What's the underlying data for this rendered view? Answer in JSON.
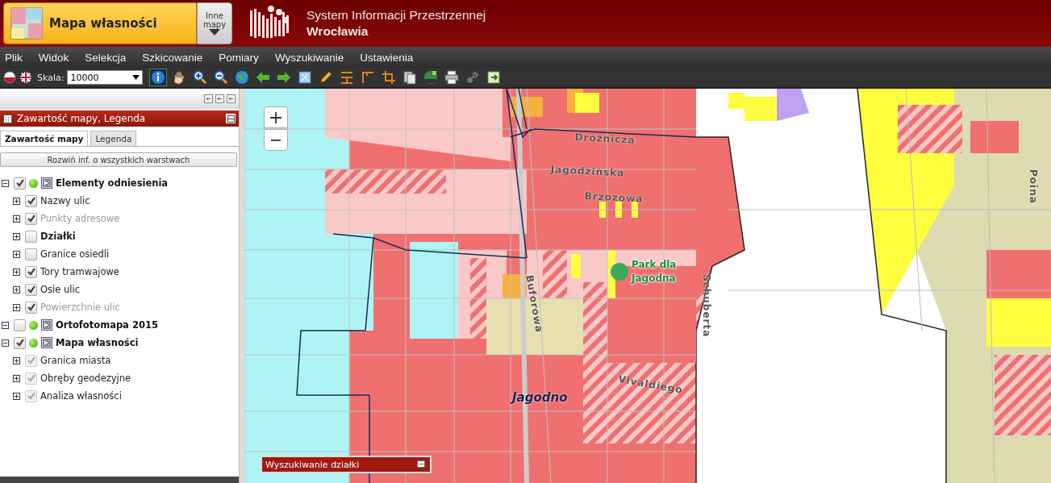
{
  "header": {
    "map_name": "Mapa własności",
    "other_maps": [
      "Inne",
      "mapy"
    ],
    "title": [
      "System Informacji Przestrzennej",
      "Wrocławia"
    ]
  },
  "menu": [
    {
      "label": "Plik"
    },
    {
      "label": "Widok"
    },
    {
      "label": "Selekcja"
    },
    {
      "label": "Szkicowanie"
    },
    {
      "label": "Pomiary"
    },
    {
      "label": "Wyszukiwanie"
    },
    {
      "label": "Ustawienia"
    }
  ],
  "toolbar": {
    "scale_label": "Skala:",
    "scale_value": "10000",
    "tools": [
      {
        "kind": "info",
        "selected": true
      },
      {
        "kind": "pan",
        "selected": false
      },
      {
        "kind": "zoom-in",
        "selected": false
      },
      {
        "kind": "zoom-out",
        "selected": false
      },
      {
        "kind": "globe",
        "selected": false
      },
      {
        "kind": "back",
        "selected": false
      },
      {
        "kind": "forward",
        "selected": false
      },
      {
        "kind": "extent",
        "selected": false
      },
      {
        "kind": "pencil",
        "selected": false
      },
      {
        "kind": "measure-h",
        "selected": false
      },
      {
        "kind": "measure-a",
        "selected": false
      },
      {
        "kind": "crop",
        "selected": false
      },
      {
        "kind": "layers",
        "selected": false
      },
      {
        "kind": "wfs",
        "selected": false
      },
      {
        "kind": "print",
        "selected": false
      },
      {
        "kind": "link",
        "selected": false
      },
      {
        "kind": "export",
        "selected": false
      }
    ]
  },
  "panel": {
    "title": "Zawartość mapy, Legenda",
    "tabs": [
      {
        "label": "Zawartość mapy",
        "selected": true
      },
      {
        "label": "Legenda",
        "selected": false
      }
    ],
    "expand_button": "Rozwiń inf. o wszystkich warstwach",
    "layers": [
      {
        "label": "Elementy odniesienia",
        "checked": true,
        "expanded": true,
        "children": [
          {
            "label": "Nazwy ulic",
            "checked": true,
            "disabled": false,
            "bold": false
          },
          {
            "label": "Punkty adresowe",
            "checked": true,
            "disabled": true,
            "bold": false
          },
          {
            "label": "Działki",
            "checked": false,
            "disabled": false,
            "bold": true
          },
          {
            "label": "Granice osiedli",
            "checked": false,
            "disabled": false,
            "bold": false
          },
          {
            "label": "Tory tramwajowe",
            "checked": true,
            "disabled": false,
            "bold": false
          },
          {
            "label": "Osie ulic",
            "checked": true,
            "disabled": false,
            "bold": false
          },
          {
            "label": "Powierzchnie ulic",
            "checked": true,
            "disabled": true,
            "bold": false
          }
        ]
      },
      {
        "label": "Ortofotomapa 2015",
        "checked": false,
        "expanded": true
      },
      {
        "label": "Mapa własności",
        "checked": true,
        "expanded": true,
        "children": [
          {
            "label": "Granica miasta",
            "checked": true,
            "disabled": false,
            "bold": false,
            "greyed_box": true
          },
          {
            "label": "Obręby geodezyjne",
            "checked": true,
            "disabled": false,
            "bold": false,
            "greyed_box": true
          },
          {
            "label": "Analiza własności",
            "checked": true,
            "disabled": false,
            "bold": false,
            "greyed_box": true
          }
        ]
      }
    ]
  },
  "map": {
    "labels": [
      {
        "text": "Dróżnicza",
        "kind": "street"
      },
      {
        "text": "Jagodzińska",
        "kind": "street"
      },
      {
        "text": "Brzozowa",
        "kind": "street"
      },
      {
        "text": "Buforowa",
        "kind": "street-vertical"
      },
      {
        "text": "Schuberta",
        "kind": "street-vertical"
      },
      {
        "text": "Vivaldiego",
        "kind": "street"
      },
      {
        "text": "Jagodno",
        "kind": "district"
      },
      {
        "text": "Poina",
        "kind": "street-vertical"
      }
    ],
    "poi": [
      "Park dla",
      "Jagodna"
    ],
    "search_window": "Wyszukiwanie działki"
  }
}
